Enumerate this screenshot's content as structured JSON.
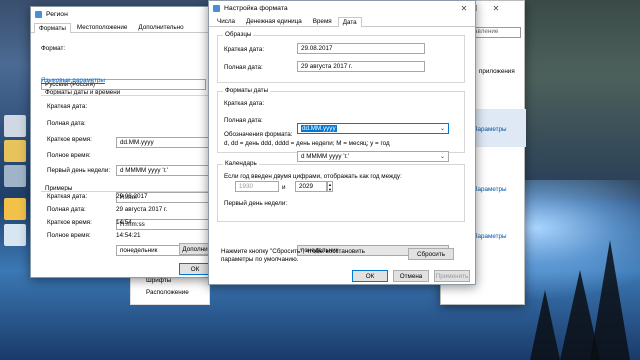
{
  "desktop": {
    "icons": [
      "computer-icon",
      "folder-icon",
      "recycle-bin-icon",
      "app-icon",
      "bin-icon"
    ]
  },
  "settings_window": {
    "search_placeholder": "авление",
    "link_label": "приложения",
    "items": [
      "Параметры",
      "Параметры",
      "Параметры"
    ],
    "bottom_items": [
      "Шрифты",
      "Расположение"
    ]
  },
  "region_window": {
    "title": "Регион",
    "tabs": [
      "Форматы",
      "Местоположение",
      "Дополнительно"
    ],
    "format_label": "Формат:",
    "format_value": "Русский (Россия)",
    "lang_link": "Языковые параметры",
    "formats_group_title": "Форматы даты и времени",
    "fields": [
      {
        "label": "Краткая дата:",
        "value": "dd.MM.yyyy"
      },
      {
        "label": "Полная дата:",
        "value": "d MMMM yyyy 'г.'"
      },
      {
        "label": "Краткое время:",
        "value": "H:mm"
      },
      {
        "label": "Полное время:",
        "value": "H:mm:ss"
      },
      {
        "label": "Первый день недели:",
        "value": "понедельник"
      }
    ],
    "examples_title": "Примеры",
    "examples": [
      {
        "label": "Краткая дата:",
        "value": "29.08.2017"
      },
      {
        "label": "Полная дата:",
        "value": "29 августа 2017 г."
      },
      {
        "label": "Краткое время:",
        "value": "14:54"
      },
      {
        "label": "Полное время:",
        "value": "14:54:21"
      }
    ],
    "extra_button": "Дополни",
    "ok_button": "ОК"
  },
  "format_dialog": {
    "title": "Настройка формата",
    "tabs": [
      "Числа",
      "Денежная единица",
      "Время",
      "Дата"
    ],
    "samples_title": "Образцы",
    "short_date_label": "Краткая дата:",
    "short_date_sample": "29.08.2017",
    "long_date_label": "Полная дата:",
    "long_date_sample": "29 августа 2017 г.",
    "date_formats_title": "Форматы даты",
    "short_date_format": "dd.MM.yyyy",
    "long_date_format": "d MMMM yyyy 'г.'",
    "notation_title": "Обозначения формата:",
    "notation_text": "d, dd = день  ddd, dddd = день недели; M = месяц; y = год",
    "calendar_title": "Календарь",
    "two_digit_text": "Если год введен двумя цифрами, отображать как год между:",
    "year_from": "1930",
    "year_and": "и",
    "year_to": "2029",
    "first_day_label": "Первый день недели:",
    "first_day_value": "понедельник",
    "reset_text": "Нажмите кнопку \"Сбросить\", чтобы восстановить параметры по умолчанию.",
    "reset_button": "Сбросить",
    "ok_button": "ОК",
    "cancel_button": "Отмена",
    "apply_button": "Применить"
  }
}
